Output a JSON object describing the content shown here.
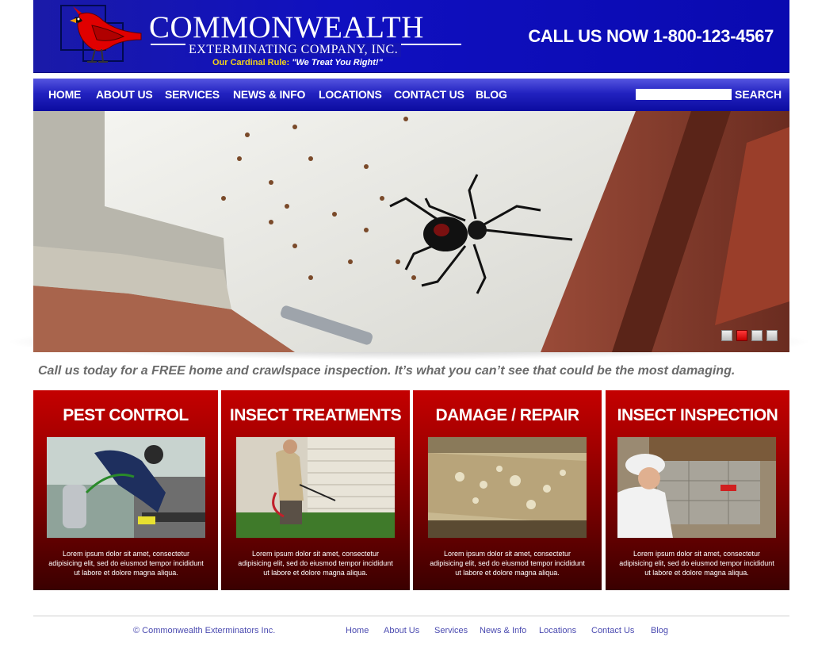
{
  "brand": {
    "name": "COMMONWEALTH",
    "subtitle": "EXTERMINATING COMPANY, INC.",
    "tagline_prefix": "Our Cardinal Rule:",
    "tagline_quote": "\"We Treat You Right!\""
  },
  "header": {
    "call_now": "CALL US NOW 1-800-123-4567"
  },
  "nav": {
    "items": [
      {
        "label": "HOME"
      },
      {
        "label": "ABOUT US"
      },
      {
        "label": "SERVICES"
      },
      {
        "label": "NEWS & INFO"
      },
      {
        "label": "LOCATIONS"
      },
      {
        "label": "CONTACT US"
      },
      {
        "label": "BLOG"
      }
    ],
    "search_value": "",
    "search_label": "SEARCH"
  },
  "hero": {
    "slide_count": 4,
    "active_slide": 2
  },
  "promo": "Call us today for a FREE home and crawlspace inspection. It’s what you can’t see that could be the most damaging.",
  "cards": [
    {
      "title": "PEST CONTROL",
      "text": "Lorem ipsum dolor sit amet, consectetur adipisicing elit, sed do eiusmod tempor incididunt ut labore et dolore magna aliqua."
    },
    {
      "title": "INSECT TREATMENTS",
      "text": "Lorem ipsum dolor sit amet, consectetur adipisicing elit, sed do eiusmod tempor incididunt ut labore et dolore magna aliqua."
    },
    {
      "title": "DAMAGE / REPAIR",
      "text": "Lorem ipsum dolor sit amet, consectetur adipisicing elit, sed do eiusmod tempor incididunt ut labore et dolore magna aliqua."
    },
    {
      "title": "INSECT INSPECTION",
      "text": "Lorem ipsum dolor sit amet, consectetur adipisicing elit, sed do eiusmod tempor incididunt ut labore et dolore magna aliqua."
    }
  ],
  "footer": {
    "copyright": "© Commonwealth Exterminators Inc.",
    "links": [
      "Home",
      "About Us",
      "Services",
      "News & Info",
      "Locations",
      "Contact Us",
      "Blog"
    ]
  },
  "colors": {
    "header_blue": "#1010c0",
    "card_red": "#a00000",
    "tagline_yellow": "#f2d21a",
    "footer_link": "#4a4ab0"
  }
}
